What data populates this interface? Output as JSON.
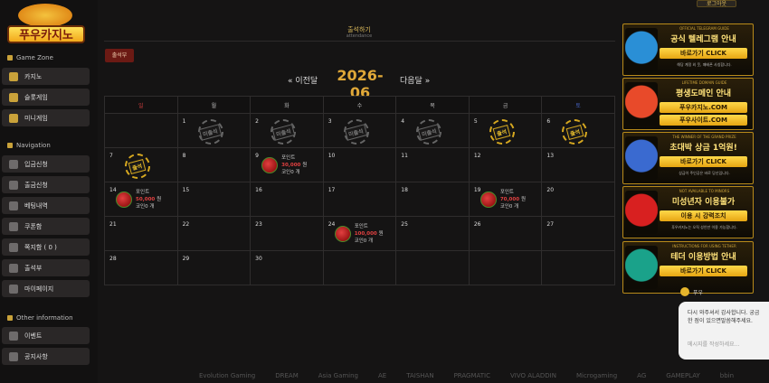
{
  "topbar": {
    "login_button": "로그아웃"
  },
  "logo": {
    "text": "푸우카지노"
  },
  "sidebar": {
    "sections": [
      {
        "title": "Game Zone",
        "items": [
          "카지노",
          "슬롯게임",
          "미니게임"
        ]
      },
      {
        "title": "Navigation",
        "items": [
          "입금신청",
          "출금신청",
          "베팅내역",
          "쿠폰함",
          "쪽지함 ( 0 )",
          "출석부",
          "마이페이지"
        ]
      },
      {
        "title": "Other information",
        "items": [
          "이벤트",
          "공지사항"
        ]
      }
    ]
  },
  "page": {
    "title": "출석하기",
    "subtitle": "attendance",
    "tab": "출석부",
    "prev": "« 이전달",
    "next": "다음달 »",
    "month": "2026-06"
  },
  "calendar": {
    "weekdays": [
      "일",
      "월",
      "화",
      "수",
      "목",
      "금",
      "토"
    ],
    "stamp_absent": "미출석",
    "stamp_present": "출석",
    "reward_label": "포인트",
    "won": "원",
    "coin_label": "코인",
    "coin_unit": "개",
    "weeks": [
      [
        {
          "d": ""
        },
        {
          "d": "1",
          "stamp": "absent"
        },
        {
          "d": "2",
          "stamp": "absent"
        },
        {
          "d": "3",
          "stamp": "absent"
        },
        {
          "d": "4",
          "stamp": "absent"
        },
        {
          "d": "5",
          "stamp": "present"
        },
        {
          "d": "6",
          "stamp": "present"
        }
      ],
      [
        {
          "d": "7",
          "stamp": "present"
        },
        {
          "d": "8"
        },
        {
          "d": "9",
          "reward": "30,000",
          "coin": "0"
        },
        {
          "d": "10"
        },
        {
          "d": "11"
        },
        {
          "d": "12"
        },
        {
          "d": "13"
        }
      ],
      [
        {
          "d": "14",
          "reward": "50,000",
          "coin": "0"
        },
        {
          "d": "15"
        },
        {
          "d": "16"
        },
        {
          "d": "17"
        },
        {
          "d": "18"
        },
        {
          "d": "19",
          "reward": "70,000",
          "coin": "0"
        },
        {
          "d": "20"
        }
      ],
      [
        {
          "d": "21"
        },
        {
          "d": "22"
        },
        {
          "d": "23"
        },
        {
          "d": "24",
          "reward": "100,000",
          "coin": "0"
        },
        {
          "d": "25"
        },
        {
          "d": "26"
        },
        {
          "d": "27"
        }
      ],
      [
        {
          "d": "28"
        },
        {
          "d": "29"
        },
        {
          "d": "30"
        },
        {
          "d": ""
        },
        {
          "d": ""
        },
        {
          "d": ""
        },
        {
          "d": ""
        }
      ]
    ]
  },
  "banners": [
    {
      "cap": "OFFICIAL TELEGRAM GUIDE",
      "head": "공식 텔레그램 안내",
      "btn": "바로가기 CLICK",
      "foot": "해당 계정 외 웃, 패배폰 사칭합니다.",
      "color": "#2a8fd6"
    },
    {
      "cap": "LIFETIME DOMAIN GUIDE",
      "head": "평생도메인 안내",
      "btn": "푸우카지노.COM",
      "foot": "",
      "btn2": "푸우사이트.COM",
      "color": "#e84a2a"
    },
    {
      "cap": "THE WINNER OF THE GRAND PRIZE",
      "head": "초대박 상금 1억원!",
      "btn": "바로가기 CLICK",
      "foot": "상금이 주인공은 바로 당신입니다.",
      "color": "#3a6ad0"
    },
    {
      "cap": "NOT AVAILABLE TO MINORS",
      "head": "미성년자 이용불가",
      "btn": "이용 시 강력조치",
      "foot": "푸우카지노는 오직 성인만 이용 가능합니다.",
      "color": "#d82020"
    },
    {
      "cap": "INSTRUCTIONS FOR USING TETHER",
      "head": "테더 이용방법 안내",
      "btn": "바로가기 CLICK",
      "foot": "",
      "color": "#1aa28a"
    }
  ],
  "chat": {
    "user": "푸우",
    "message": "다시 와주셔서 감사합니다. 궁금한 점이 있으면말씀해주세요.",
    "placeholder": "메시지를 작성하세요..."
  },
  "providers": [
    "Evolution Gaming",
    "DREAM",
    "Asia Gaming",
    "AE",
    "TAISHAN",
    "PRAGMATIC",
    "VIVO ALADDIN",
    "Microgaming",
    "AG",
    "GAMEPLAY",
    "bbin"
  ]
}
